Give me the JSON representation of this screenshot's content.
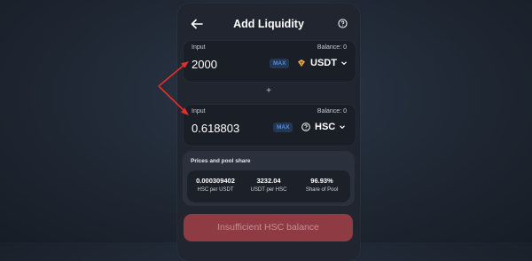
{
  "header": {
    "title": "Add Liquidity",
    "back_icon": "arrow-left-icon",
    "help_icon": "question-circle-icon"
  },
  "input_a": {
    "label": "Input",
    "balance": "Balance: 0",
    "amount": "2000",
    "max_label": "MAX",
    "token": "USDT",
    "token_icon": "usdt-token-icon"
  },
  "plus": "+",
  "input_b": {
    "label": "Input",
    "balance": "Balance: 0",
    "amount": "0.618803",
    "max_label": "MAX",
    "token": "HSC",
    "token_icon": "question-circle-icon"
  },
  "prices": {
    "title": "Prices and pool share",
    "stats": [
      {
        "value": "0.000309402",
        "label": "HSC per USDT"
      },
      {
        "value": "3232.04",
        "label": "USDT per HSC"
      },
      {
        "value": "96.93%",
        "label": "Share of Pool"
      }
    ]
  },
  "action": {
    "label": "Insufficient HSC balance"
  },
  "colors": {
    "accent_blue": "#4f8de8",
    "button_red": "#8e3b43",
    "annotation_red": "#e0302a"
  }
}
